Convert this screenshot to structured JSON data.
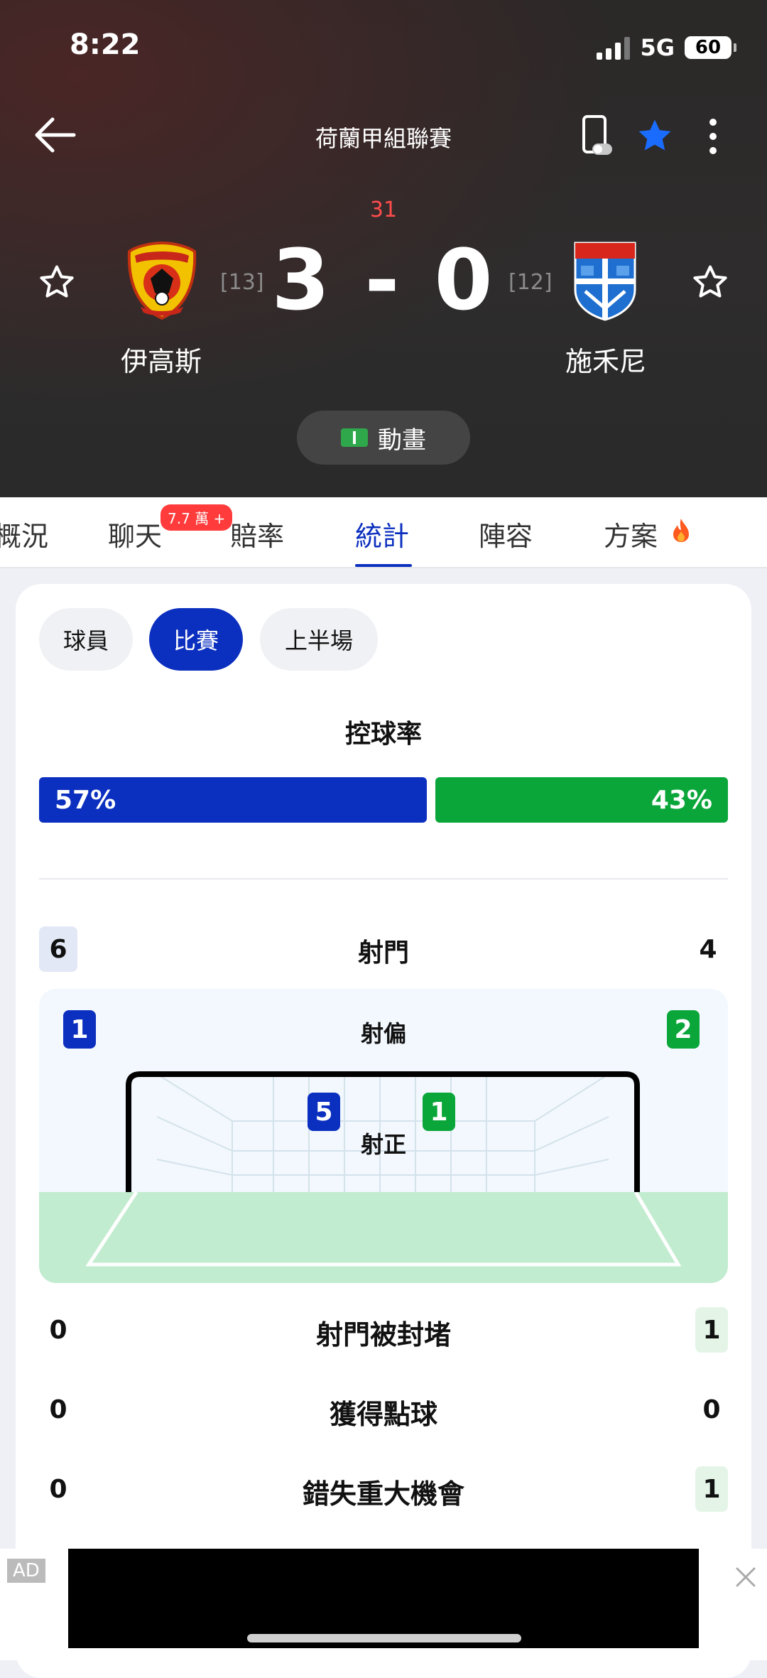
{
  "status": {
    "time": "8:22",
    "network": "5G",
    "battery": "60"
  },
  "header": {
    "league": "荷蘭甲組聯賽"
  },
  "match": {
    "minute": "31",
    "score": "3 - 0",
    "home": {
      "name": "伊高斯",
      "rank": "[13]"
    },
    "away": {
      "name": "施禾尼",
      "rank": "[12]"
    },
    "animation_label": "動畫"
  },
  "tabs": [
    {
      "label": "概況"
    },
    {
      "label": "聊天",
      "badge": "7.7 萬 +"
    },
    {
      "label": "賠率"
    },
    {
      "label": "統計"
    },
    {
      "label": "陣容"
    },
    {
      "label": "方案"
    }
  ],
  "filters": [
    {
      "label": "球員"
    },
    {
      "label": "比賽"
    },
    {
      "label": "上半場"
    }
  ],
  "possession": {
    "title": "控球率",
    "home": "57%",
    "away": "43%",
    "home_value": 57,
    "away_value": 43
  },
  "shots": {
    "label": "射門",
    "home": "6",
    "away": "4",
    "off_target": {
      "label": "射偏",
      "home": "1",
      "away": "2"
    },
    "on_target": {
      "label": "射正",
      "home": "5",
      "away": "1"
    }
  },
  "stats": [
    {
      "label": "射門被封堵",
      "home": "0",
      "away": "1"
    },
    {
      "label": "獲得點球",
      "home": "0",
      "away": "0"
    },
    {
      "label": "錯失重大機會",
      "home": "0",
      "away": "1"
    }
  ],
  "ad": {
    "tag": "AD"
  },
  "colors": {
    "home": "#0b2fbf",
    "away": "#0aa63a",
    "live_minute": "#ff4d4d"
  }
}
